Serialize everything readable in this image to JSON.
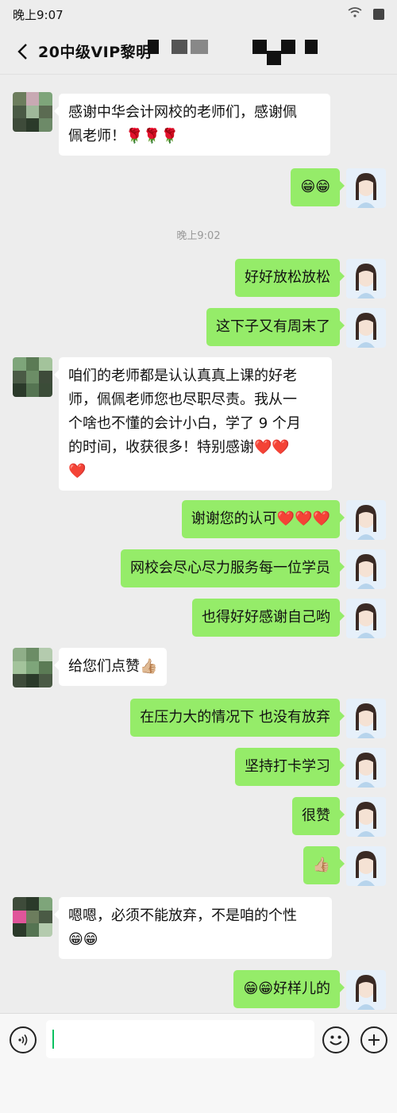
{
  "status": {
    "time": "晚上9:07"
  },
  "header": {
    "title": "20中级VIP黎明"
  },
  "chat": {
    "timestamp": "晚上9:02",
    "messages": [
      {
        "side": "in",
        "line1": "感谢中华会计网校的老师们，感谢佩",
        "line2": "佩老师！🌹🌹🌹"
      },
      {
        "side": "out",
        "text": "😁😁"
      },
      {
        "side": "out",
        "text": "好好放松放松"
      },
      {
        "side": "out",
        "text": "这下子又有周末了"
      },
      {
        "side": "in",
        "line1": "咱们的老师都是认认真真上课的好老",
        "line2": "师，佩佩老师您也尽职尽责。我从一",
        "line3": "个啥也不懂的会计小白，学了 9 个月",
        "line4": "的时间，收获很多！特别感谢❤️❤️",
        "line5": "❤️"
      },
      {
        "side": "out",
        "text": "谢谢您的认可❤️❤️❤️"
      },
      {
        "side": "out",
        "text": "网校会尽心尽力服务每一位学员"
      },
      {
        "side": "out",
        "text": "也得好好感谢自己哟"
      },
      {
        "side": "in",
        "text": "给您们点赞👍🏼"
      },
      {
        "side": "out",
        "text": "在压力大的情况下 也没有放弃"
      },
      {
        "side": "out",
        "text": "坚持打卡学习"
      },
      {
        "side": "out",
        "text": "很赞"
      },
      {
        "side": "out",
        "text": "👍🏼"
      },
      {
        "side": "in",
        "line1": "嗯嗯，必须不能放弃，不是咱的个性",
        "line2": "😁😁"
      },
      {
        "side": "out",
        "text": "😁😁好样儿的"
      }
    ]
  },
  "icons": {
    "back": "chevron-left-icon",
    "voice": "voice-icon",
    "emoji": "emoji-icon",
    "plus": "plus-icon",
    "wifi": "wifi-icon",
    "battery": "battery-icon"
  },
  "colors": {
    "background": "#ededed",
    "outgoing_bubble": "#95ec69",
    "incoming_bubble": "#ffffff",
    "caret": "#07c160"
  }
}
